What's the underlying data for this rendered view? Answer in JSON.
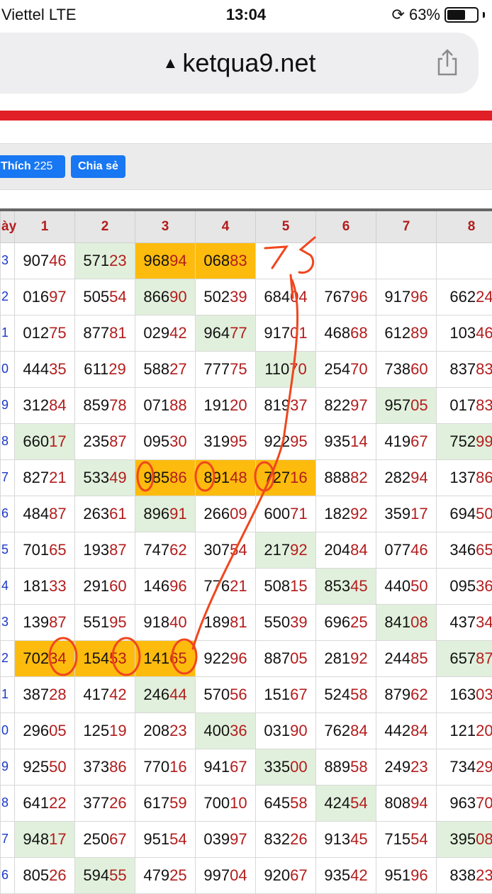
{
  "status_bar": {
    "carrier": "Viettel  LTE",
    "time": "13:04",
    "battery_text": "63%",
    "battery_level": 0.63
  },
  "browser": {
    "url": "ketqua9.net",
    "lock_icon": "lock-icon",
    "share_icon": "share-icon"
  },
  "actions": {
    "like_label": "Thích",
    "like_count": "225",
    "share_label": "Chia sẻ"
  },
  "table": {
    "columns": [
      "ày",
      "1",
      "2",
      "3",
      "4",
      "5",
      "6",
      "7",
      "8"
    ],
    "rows": [
      {
        "h": "3",
        "cells": [
          {
            "v": "907",
            "t": "46"
          },
          {
            "v": "571",
            "t": "23",
            "c": "green"
          },
          {
            "v": "968",
            "t": "94",
            "c": "orange"
          },
          {
            "v": "068",
            "t": "83",
            "c": "orange"
          },
          {
            "v": "",
            "t": ""
          },
          {
            "v": "",
            "t": ""
          },
          {
            "v": "",
            "t": ""
          },
          {
            "v": "",
            "t": ""
          }
        ]
      },
      {
        "h": "2",
        "cells": [
          {
            "v": "016",
            "t": "97"
          },
          {
            "v": "505",
            "t": "54"
          },
          {
            "v": "866",
            "t": "90",
            "c": "green"
          },
          {
            "v": "502",
            "t": "39"
          },
          {
            "v": "684",
            "t": "04"
          },
          {
            "v": "767",
            "t": "96"
          },
          {
            "v": "917",
            "t": "96"
          },
          {
            "v": "662",
            "t": "24"
          }
        ]
      },
      {
        "h": "1",
        "cells": [
          {
            "v": "012",
            "t": "75"
          },
          {
            "v": "877",
            "t": "81"
          },
          {
            "v": "029",
            "t": "42"
          },
          {
            "v": "964",
            "t": "77",
            "c": "green"
          },
          {
            "v": "917",
            "t": "01"
          },
          {
            "v": "468",
            "t": "68"
          },
          {
            "v": "612",
            "t": "89"
          },
          {
            "v": "103",
            "t": "46"
          }
        ]
      },
      {
        "h": "0",
        "cells": [
          {
            "v": "444",
            "t": "35"
          },
          {
            "v": "611",
            "t": "29"
          },
          {
            "v": "588",
            "t": "27"
          },
          {
            "v": "777",
            "t": "75"
          },
          {
            "v": "110",
            "t": "70",
            "c": "green"
          },
          {
            "v": "254",
            "t": "70"
          },
          {
            "v": "738",
            "t": "60"
          },
          {
            "v": "837",
            "t": "83"
          }
        ]
      },
      {
        "h": "9",
        "cells": [
          {
            "v": "312",
            "t": "84"
          },
          {
            "v": "859",
            "t": "78"
          },
          {
            "v": "071",
            "t": "88"
          },
          {
            "v": "191",
            "t": "20"
          },
          {
            "v": "819",
            "t": "37"
          },
          {
            "v": "822",
            "t": "97"
          },
          {
            "v": "957",
            "t": "05",
            "c": "green"
          },
          {
            "v": "017",
            "t": "83"
          }
        ]
      },
      {
        "h": "8",
        "cells": [
          {
            "v": "660",
            "t": "17",
            "c": "green"
          },
          {
            "v": "235",
            "t": "87"
          },
          {
            "v": "095",
            "t": "30"
          },
          {
            "v": "319",
            "t": "95"
          },
          {
            "v": "922",
            "t": "95"
          },
          {
            "v": "935",
            "t": "14"
          },
          {
            "v": "419",
            "t": "67"
          },
          {
            "v": "752",
            "t": "99",
            "c": "green"
          }
        ]
      },
      {
        "h": "7",
        "cells": [
          {
            "v": "827",
            "t": "21"
          },
          {
            "v": "533",
            "t": "49",
            "c": "green"
          },
          {
            "v": "985",
            "t": "86",
            "c": "orange"
          },
          {
            "v": "891",
            "t": "48",
            "c": "orange"
          },
          {
            "v": "727",
            "t": "16",
            "c": "orange"
          },
          {
            "v": "888",
            "t": "82"
          },
          {
            "v": "282",
            "t": "94"
          },
          {
            "v": "137",
            "t": "86"
          }
        ]
      },
      {
        "h": "6",
        "cells": [
          {
            "v": "484",
            "t": "87"
          },
          {
            "v": "263",
            "t": "61"
          },
          {
            "v": "896",
            "t": "91",
            "c": "green"
          },
          {
            "v": "266",
            "t": "09"
          },
          {
            "v": "600",
            "t": "71"
          },
          {
            "v": "182",
            "t": "92"
          },
          {
            "v": "359",
            "t": "17"
          },
          {
            "v": "694",
            "t": "50"
          }
        ]
      },
      {
        "h": "5",
        "cells": [
          {
            "v": "701",
            "t": "65"
          },
          {
            "v": "193",
            "t": "87"
          },
          {
            "v": "747",
            "t": "62"
          },
          {
            "v": "307",
            "t": "54"
          },
          {
            "v": "217",
            "t": "92",
            "c": "green"
          },
          {
            "v": "204",
            "t": "84"
          },
          {
            "v": "077",
            "t": "46"
          },
          {
            "v": "346",
            "t": "65"
          }
        ]
      },
      {
        "h": "4",
        "cells": [
          {
            "v": "181",
            "t": "33"
          },
          {
            "v": "291",
            "t": "60"
          },
          {
            "v": "146",
            "t": "96"
          },
          {
            "v": "776",
            "t": "21"
          },
          {
            "v": "508",
            "t": "15"
          },
          {
            "v": "853",
            "t": "45",
            "c": "green"
          },
          {
            "v": "440",
            "t": "50"
          },
          {
            "v": "095",
            "t": "36"
          }
        ]
      },
      {
        "h": "3",
        "cells": [
          {
            "v": "139",
            "t": "87"
          },
          {
            "v": "551",
            "t": "95"
          },
          {
            "v": "918",
            "t": "40"
          },
          {
            "v": "189",
            "t": "81"
          },
          {
            "v": "550",
            "t": "39"
          },
          {
            "v": "696",
            "t": "25"
          },
          {
            "v": "841",
            "t": "08",
            "c": "green"
          },
          {
            "v": "437",
            "t": "34"
          }
        ]
      },
      {
        "h": "2",
        "cells": [
          {
            "v": "702",
            "t": "34",
            "c": "orange"
          },
          {
            "v": "154",
            "t": "53",
            "c": "orange"
          },
          {
            "v": "141",
            "t": "65",
            "c": "orange"
          },
          {
            "v": "922",
            "t": "96"
          },
          {
            "v": "887",
            "t": "05"
          },
          {
            "v": "281",
            "t": "92"
          },
          {
            "v": "244",
            "t": "85"
          },
          {
            "v": "657",
            "t": "87",
            "c": "green"
          }
        ]
      },
      {
        "h": "1",
        "cells": [
          {
            "v": "387",
            "t": "28"
          },
          {
            "v": "417",
            "t": "42"
          },
          {
            "v": "246",
            "t": "44",
            "c": "green"
          },
          {
            "v": "570",
            "t": "56"
          },
          {
            "v": "151",
            "t": "67"
          },
          {
            "v": "524",
            "t": "58"
          },
          {
            "v": "879",
            "t": "62"
          },
          {
            "v": "163",
            "t": "03"
          }
        ]
      },
      {
        "h": "0",
        "cells": [
          {
            "v": "296",
            "t": "05"
          },
          {
            "v": "125",
            "t": "19"
          },
          {
            "v": "208",
            "t": "23"
          },
          {
            "v": "400",
            "t": "36",
            "c": "green"
          },
          {
            "v": "031",
            "t": "90"
          },
          {
            "v": "762",
            "t": "84"
          },
          {
            "v": "442",
            "t": "84"
          },
          {
            "v": "121",
            "t": "20"
          }
        ]
      },
      {
        "h": "9",
        "cells": [
          {
            "v": "925",
            "t": "50"
          },
          {
            "v": "373",
            "t": "86"
          },
          {
            "v": "770",
            "t": "16"
          },
          {
            "v": "941",
            "t": "67"
          },
          {
            "v": "335",
            "t": "00",
            "c": "green"
          },
          {
            "v": "889",
            "t": "58"
          },
          {
            "v": "249",
            "t": "23"
          },
          {
            "v": "734",
            "t": "29"
          }
        ]
      },
      {
        "h": "8",
        "cells": [
          {
            "v": "641",
            "t": "22"
          },
          {
            "v": "377",
            "t": "26"
          },
          {
            "v": "617",
            "t": "59"
          },
          {
            "v": "700",
            "t": "10"
          },
          {
            "v": "645",
            "t": "58"
          },
          {
            "v": "424",
            "t": "54",
            "c": "green"
          },
          {
            "v": "808",
            "t": "94"
          },
          {
            "v": "963",
            "t": "70"
          }
        ]
      },
      {
        "h": "7",
        "cells": [
          {
            "v": "948",
            "t": "17",
            "c": "green"
          },
          {
            "v": "250",
            "t": "67"
          },
          {
            "v": "951",
            "t": "54"
          },
          {
            "v": "039",
            "t": "97"
          },
          {
            "v": "832",
            "t": "26"
          },
          {
            "v": "913",
            "t": "45"
          },
          {
            "v": "715",
            "t": "54"
          },
          {
            "v": "395",
            "t": "08",
            "c": "green"
          }
        ]
      },
      {
        "h": "6",
        "cells": [
          {
            "v": "805",
            "t": "26"
          },
          {
            "v": "594",
            "t": "55",
            "c": "green"
          },
          {
            "v": "479",
            "t": "25"
          },
          {
            "v": "997",
            "t": "04"
          },
          {
            "v": "920",
            "t": "67"
          },
          {
            "v": "935",
            "t": "42"
          },
          {
            "v": "951",
            "t": "96"
          },
          {
            "v": "838",
            "t": "23"
          }
        ]
      }
    ]
  },
  "annotation": {
    "handwritten_note": "75",
    "color": "#f0461e"
  },
  "colors": {
    "green": "#e1f0dc",
    "orange": "#fdbb0d",
    "tail_red": "#b31c1c",
    "rowhead_blue": "#1a37c8",
    "fb_blue": "#1877f2",
    "strip_red": "#e01f26"
  }
}
